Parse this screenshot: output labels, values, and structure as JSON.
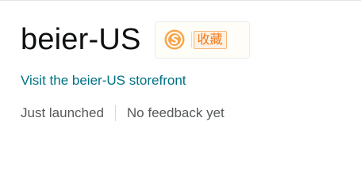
{
  "store": {
    "name": "beier-US",
    "favorite_icon": "coin-s-icon",
    "favorite_label": "收藏",
    "storefront_link": "Visit the beier-US storefront"
  },
  "status": {
    "launch": "Just launched",
    "feedback": "No feedback yet"
  },
  "colors": {
    "link": "#007185",
    "accent_orange": "#f27a1a",
    "text_dark": "#0f1111",
    "text_muted": "#565959"
  }
}
